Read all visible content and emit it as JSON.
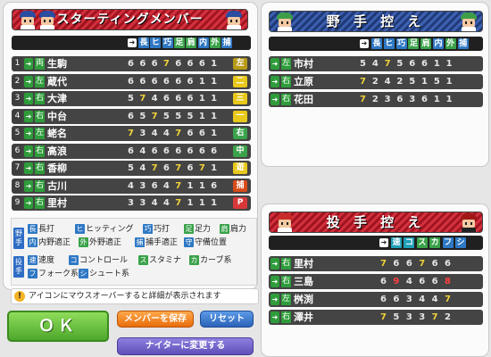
{
  "starting": {
    "title": "スターティングメンバー",
    "headers": [
      "長",
      "ヒ",
      "巧",
      "足",
      "肩",
      "内",
      "外",
      "捕"
    ],
    "rows": [
      {
        "num": "1",
        "hand": "両",
        "name": "生駒",
        "stats": [
          "6",
          "6",
          "6",
          "7",
          "6",
          "6",
          "6",
          "1"
        ],
        "pos": "左"
      },
      {
        "num": "2",
        "hand": "左",
        "name": "蔵代",
        "stats": [
          "6",
          "6",
          "6",
          "6",
          "6",
          "6",
          "1",
          "1"
        ],
        "pos": "二"
      },
      {
        "num": "3",
        "hand": "右",
        "name": "大津",
        "stats": [
          "5",
          "7",
          "4",
          "6",
          "6",
          "6",
          "1",
          "1"
        ],
        "pos": "三"
      },
      {
        "num": "4",
        "hand": "右",
        "name": "中台",
        "stats": [
          "6",
          "5",
          "7",
          "5",
          "5",
          "5",
          "1",
          "1"
        ],
        "pos": "一"
      },
      {
        "num": "5",
        "hand": "左",
        "name": "蛯名",
        "stats": [
          "7",
          "3",
          "4",
          "4",
          "7",
          "6",
          "6",
          "1"
        ],
        "pos": "右"
      },
      {
        "num": "6",
        "hand": "右",
        "name": "高浪",
        "stats": [
          "6",
          "4",
          "6",
          "6",
          "6",
          "6",
          "6",
          "6"
        ],
        "pos": "中"
      },
      {
        "num": "7",
        "hand": "右",
        "name": "香柳",
        "stats": [
          "5",
          "4",
          "7",
          "6",
          "7",
          "6",
          "7",
          "1"
        ],
        "pos": "遊"
      },
      {
        "num": "8",
        "hand": "右",
        "name": "古川",
        "stats": [
          "4",
          "3",
          "6",
          "4",
          "7",
          "1",
          "1",
          "6"
        ],
        "pos": "捕"
      },
      {
        "num": "9",
        "hand": "右",
        "name": "里村",
        "stats": [
          "3",
          "3",
          "4",
          "4",
          "7",
          "1",
          "1",
          "1"
        ],
        "pos": "P"
      }
    ]
  },
  "legend": {
    "fielder_label": "野手",
    "pitcher_label": "投手",
    "fielder_items": [
      {
        "k": "長",
        "t": "長打"
      },
      {
        "k": "ヒ",
        "t": "ヒッティング"
      },
      {
        "k": "巧",
        "t": "巧打"
      },
      {
        "k": "足",
        "t": "足力"
      },
      {
        "k": "肩",
        "t": "肩力"
      },
      {
        "k": "内",
        "t": "内野適正"
      },
      {
        "k": "外",
        "t": "外野適正"
      },
      {
        "k": "捕",
        "t": "捕手適正"
      },
      {
        "k": "守",
        "t": "守備位置"
      }
    ],
    "pitcher_items": [
      {
        "k": "速",
        "t": "速度"
      },
      {
        "k": "コ",
        "t": "コントロール"
      },
      {
        "k": "ス",
        "t": "スタミナ"
      },
      {
        "k": "カ",
        "t": "カーブ系"
      },
      {
        "k": "フ",
        "t": "フォーク系"
      },
      {
        "k": "シ",
        "t": "シュート系"
      }
    ]
  },
  "notice": "アイコンにマウスオーバーすると詳細が表示されます",
  "buttons": {
    "ok": "ＯＫ",
    "save": "メンバーを保存",
    "reset": "リセット",
    "night": "ナイターに変更する"
  },
  "bench": {
    "title": "野 手 控 え",
    "headers": [
      "長",
      "ヒ",
      "巧",
      "足",
      "肩",
      "内",
      "外",
      "捕"
    ],
    "rows": [
      {
        "hand": "左",
        "name": "市村",
        "stats": [
          "5",
          "4",
          "7",
          "5",
          "6",
          "6",
          "1",
          "1"
        ]
      },
      {
        "hand": "右",
        "name": "立原",
        "stats": [
          "7",
          "2",
          "4",
          "2",
          "5",
          "1",
          "5",
          "1"
        ]
      },
      {
        "hand": "右",
        "name": "花田",
        "stats": [
          "7",
          "2",
          "3",
          "6",
          "3",
          "6",
          "1",
          "1"
        ]
      }
    ]
  },
  "pitchers": {
    "title": "投 手 控 え",
    "headers": [
      "速",
      "コ",
      "ス",
      "カ",
      "フ",
      "シ"
    ],
    "rows": [
      {
        "hand": "右",
        "name": "里村",
        "stats": [
          "7",
          "6",
          "6",
          "7",
          "6",
          "6"
        ]
      },
      {
        "hand": "右",
        "name": "三島",
        "stats": [
          "6",
          "9",
          "4",
          "6",
          "6",
          "8"
        ]
      },
      {
        "hand": "左",
        "name": "桝渕",
        "stats": [
          "6",
          "6",
          "3",
          "4",
          "4",
          "7"
        ]
      },
      {
        "hand": "右",
        "name": "澤井",
        "stats": [
          "7",
          "5",
          "3",
          "3",
          "7",
          "2"
        ]
      }
    ]
  },
  "colors": {
    "ok_green": "#5fbf3a",
    "save_orange": "#f07c14",
    "reset_blue": "#2f72c9",
    "night_purple": "#7262c7"
  }
}
